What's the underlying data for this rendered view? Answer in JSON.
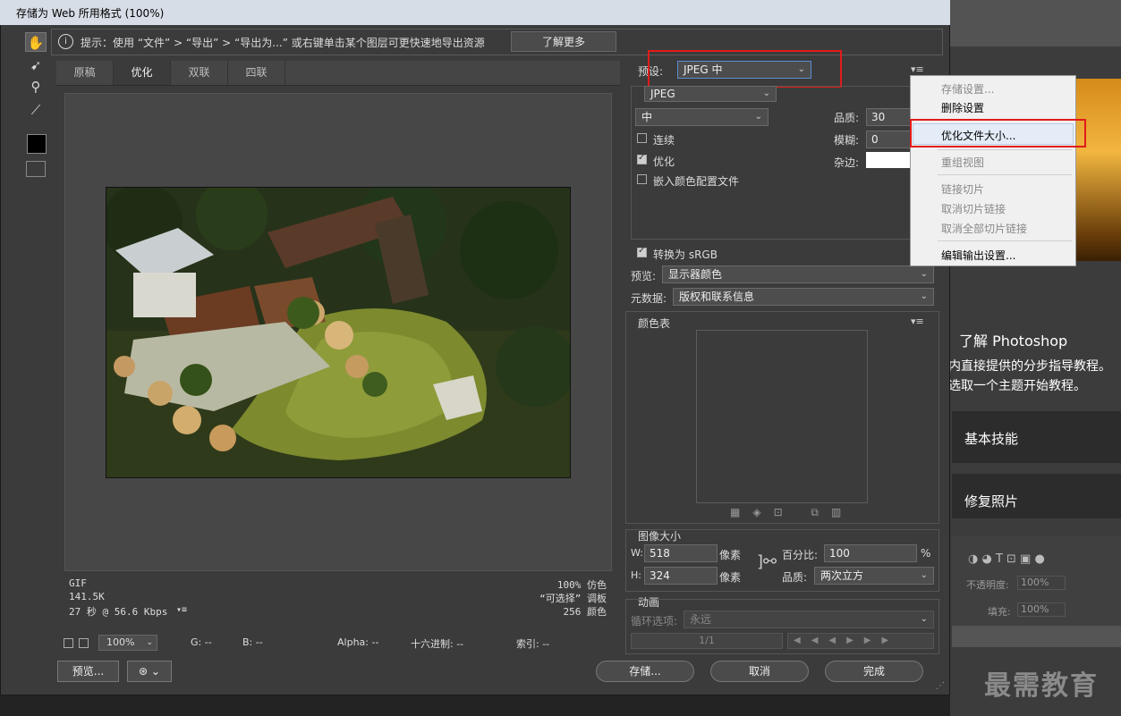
{
  "dialog": {
    "title": "存储为 Web 所用格式 (100%)",
    "tip": "提示：使用 “文件” > “导出” > “导出为...” 或右键单击某个图层可更快速地导出资源",
    "learn_more": "了解更多"
  },
  "tabs": [
    "原稿",
    "优化",
    "双联",
    "四联"
  ],
  "preview_info": {
    "format": "GIF",
    "size": "141.5K",
    "time": "27 秒 @ 56.6 Kbps",
    "dither": "100% 仿色",
    "palette": "“可选择” 调板",
    "colors": "256 颜色"
  },
  "status": {
    "zoom": "100%",
    "g": "G: --",
    "b": "B: --",
    "alpha": "Alpha: --",
    "hex": "十六进制: --",
    "index": "索引: --"
  },
  "buttons": {
    "preview": "预览...",
    "save": "存储...",
    "cancel": "取消",
    "done": "完成"
  },
  "settings": {
    "preset_label": "预设:",
    "preset_value": "JPEG 中",
    "format": "JPEG",
    "quality_level": "中",
    "quality_label": "品质:",
    "quality_value": "30",
    "blur_label": "模糊:",
    "blur_value": "0",
    "matte_label": "杂边:",
    "progressive": "连续",
    "optimized": "优化",
    "embed_profile": "嵌入颜色配置文件",
    "convert_srgb": "转换为 sRGB",
    "preview_label": "预览:",
    "preview_value": "显示器颜色",
    "metadata_label": "元数据:",
    "metadata_value": "版权和联系信息",
    "color_table": "颜色表"
  },
  "image_size": {
    "title": "图像大小",
    "w_label": "W:",
    "w_value": "518",
    "h_label": "H:",
    "h_value": "324",
    "unit": "像素",
    "percent_label": "百分比:",
    "percent_value": "100",
    "percent_unit": "%",
    "quality_label": "品质:",
    "quality_value": "两次立方"
  },
  "animation": {
    "title": "动画",
    "loop_label": "循环选项:",
    "loop_value": "永远",
    "frame": "1/1"
  },
  "context_menu": {
    "items": [
      {
        "label": "存储设置...",
        "disabled": true
      },
      {
        "label": "删除设置",
        "disabled": false
      },
      {
        "label": "优化文件大小...",
        "disabled": false
      },
      {
        "label": "重组视图",
        "disabled": true
      },
      {
        "label": "链接切片",
        "disabled": true
      },
      {
        "label": "取消切片链接",
        "disabled": true
      },
      {
        "label": "取消全部切片链接",
        "disabled": true
      },
      {
        "label": "编辑输出设置...",
        "disabled": false
      }
    ]
  },
  "background": {
    "learn_title": "了解 Photoshop",
    "learn_line1": "内直接提供的分步指导教程。",
    "learn_line2": "选取一个主题开始教程。",
    "card1": "基本技能",
    "card2": "修复照片",
    "opacity": "不透明度:",
    "opacity_value": "100%",
    "fill": "填充:",
    "fill_value": "100%",
    "watermark": "最需教育"
  },
  "colors": {
    "highlight_red": "#e21b1b",
    "dialog_bg": "#3b3b3b",
    "menu_bg": "#f0f0f0"
  }
}
